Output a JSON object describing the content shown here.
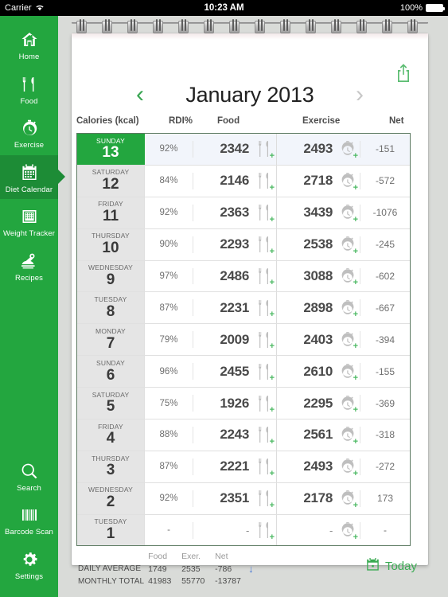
{
  "status_bar": {
    "carrier": "Carrier",
    "wifi_icon": "wifi-icon",
    "time": "10:23 AM",
    "battery_percent": "100%"
  },
  "sidebar": {
    "accent": "#23a63f",
    "selected_bg": "#1d8c36",
    "top_items": [
      {
        "label": "Home",
        "icon": "home-icon",
        "selected": false
      },
      {
        "label": "Food",
        "icon": "fork-knife-icon",
        "selected": false
      },
      {
        "label": "Exercise",
        "icon": "stopwatch-icon",
        "selected": false
      },
      {
        "label": "Diet Calendar",
        "icon": "calendar-icon",
        "selected": true
      },
      {
        "label": "Weight Tracker",
        "icon": "scale-icon",
        "selected": false
      },
      {
        "label": "Recipes",
        "icon": "recipes-icon",
        "selected": false
      }
    ],
    "bottom_items": [
      {
        "label": "Search",
        "icon": "search-icon",
        "selected": false
      },
      {
        "label": "Barcode Scan",
        "icon": "barcode-icon",
        "selected": false
      },
      {
        "label": "Settings",
        "icon": "gear-icon",
        "selected": false
      }
    ]
  },
  "header": {
    "month_title": "January 2013",
    "prev_arrow": "‹",
    "next_arrow": "›",
    "prev_enabled_color": "#39a552",
    "next_disabled_color": "#c7c7c7",
    "share_icon": "share-icon"
  },
  "columns": {
    "calories": "Calories (kcal)",
    "rdi": "RDI%",
    "food": "Food",
    "exercise": "Exercise",
    "net": "Net"
  },
  "rows": [
    {
      "dayname": "SUNDAY",
      "daynum": "13",
      "rdi": "92%",
      "food": "2342",
      "exercise": "2493",
      "net": "-151",
      "selected": true
    },
    {
      "dayname": "SATURDAY",
      "daynum": "12",
      "rdi": "84%",
      "food": "2146",
      "exercise": "2718",
      "net": "-572",
      "selected": false
    },
    {
      "dayname": "FRIDAY",
      "daynum": "11",
      "rdi": "92%",
      "food": "2363",
      "exercise": "3439",
      "net": "-1076",
      "selected": false
    },
    {
      "dayname": "THURSDAY",
      "daynum": "10",
      "rdi": "90%",
      "food": "2293",
      "exercise": "2538",
      "net": "-245",
      "selected": false
    },
    {
      "dayname": "WEDNESDAY",
      "daynum": "9",
      "rdi": "97%",
      "food": "2486",
      "exercise": "3088",
      "net": "-602",
      "selected": false
    },
    {
      "dayname": "TUESDAY",
      "daynum": "8",
      "rdi": "87%",
      "food": "2231",
      "exercise": "2898",
      "net": "-667",
      "selected": false
    },
    {
      "dayname": "MONDAY",
      "daynum": "7",
      "rdi": "79%",
      "food": "2009",
      "exercise": "2403",
      "net": "-394",
      "selected": false
    },
    {
      "dayname": "SUNDAY",
      "daynum": "6",
      "rdi": "96%",
      "food": "2455",
      "exercise": "2610",
      "net": "-155",
      "selected": false
    },
    {
      "dayname": "SATURDAY",
      "daynum": "5",
      "rdi": "75%",
      "food": "1926",
      "exercise": "2295",
      "net": "-369",
      "selected": false
    },
    {
      "dayname": "FRIDAY",
      "daynum": "4",
      "rdi": "88%",
      "food": "2243",
      "exercise": "2561",
      "net": "-318",
      "selected": false
    },
    {
      "dayname": "THURSDAY",
      "daynum": "3",
      "rdi": "87%",
      "food": "2221",
      "exercise": "2493",
      "net": "-272",
      "selected": false
    },
    {
      "dayname": "WEDNESDAY",
      "daynum": "2",
      "rdi": "92%",
      "food": "2351",
      "exercise": "2178",
      "net": "173",
      "selected": false
    },
    {
      "dayname": "TUESDAY",
      "daynum": "1",
      "rdi": "-",
      "food": "-",
      "exercise": "-",
      "net": "-",
      "selected": false
    }
  ],
  "footer": {
    "head_food": "Food",
    "head_exer": "Exer.",
    "head_net": "Net",
    "daily_average_label": "DAILY AVERAGE",
    "daily_average_food": "1749",
    "daily_average_exer": "2535",
    "daily_average_net": "-786",
    "trend_arrow": "↓",
    "monthly_total_label": "MONTHLY TOTAL",
    "monthly_total_food": "41983",
    "monthly_total_exer": "55770",
    "monthly_total_net": "-13787",
    "today_label": "Today",
    "today_icon": "calendar-today-icon"
  },
  "icons": {
    "food_row_icon": "fork-knife-icon",
    "exercise_row_icon": "stopwatch-icon",
    "add_badge": "+"
  }
}
